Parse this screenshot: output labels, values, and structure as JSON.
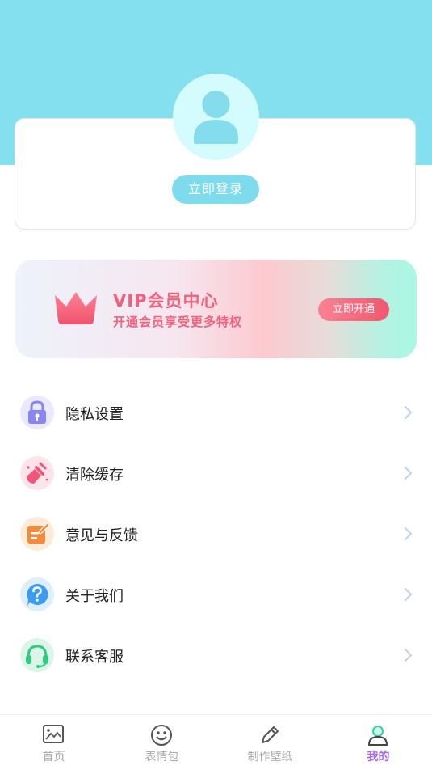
{
  "profile": {
    "avatar_icon": "user-icon",
    "login_label": "立即登录"
  },
  "vip": {
    "title": "VIP会员中心",
    "subtitle": "开通会员享受更多特权",
    "button_label": "立即开通",
    "icon": "crown-icon",
    "accent_color": "#f2607b"
  },
  "menu": {
    "items": [
      {
        "label": "隐私设置",
        "icon": "lock-icon",
        "color": "#8c84f3"
      },
      {
        "label": "清除缓存",
        "icon": "broom-icon",
        "color": "#f0577a"
      },
      {
        "label": "意见与反馈",
        "icon": "edit-note-icon",
        "color": "#f58a3c"
      },
      {
        "label": "关于我们",
        "icon": "question-icon",
        "color": "#3a9bf0"
      },
      {
        "label": "联系客服",
        "icon": "headset-icon",
        "color": "#2dcc7f"
      }
    ]
  },
  "tabbar": {
    "tabs": [
      {
        "label": "首页",
        "icon": "image-icon"
      },
      {
        "label": "表情包",
        "icon": "smiley-icon"
      },
      {
        "label": "制作壁纸",
        "icon": "pencil-icon"
      },
      {
        "label": "我的",
        "icon": "user-icon",
        "active": true
      }
    ],
    "active_color": "#a56ae6"
  }
}
